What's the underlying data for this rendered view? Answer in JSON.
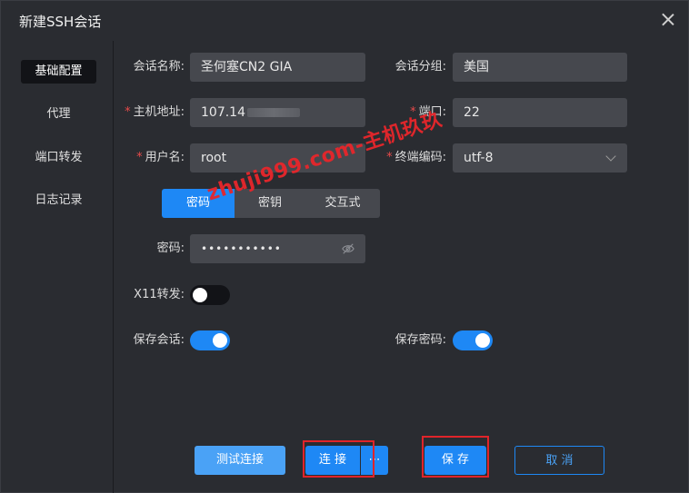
{
  "window": {
    "title": "新建SSH会话"
  },
  "sidebar": {
    "items": [
      {
        "label": "基础配置",
        "active": true
      },
      {
        "label": "代理",
        "active": false
      },
      {
        "label": "端口转发",
        "active": false
      },
      {
        "label": "日志记录",
        "active": false
      }
    ]
  },
  "form": {
    "session_name": {
      "label": "会话名称:",
      "value": "圣何塞CN2 GIA"
    },
    "session_group": {
      "label": "会话分组:",
      "value": "美国"
    },
    "host": {
      "label": "主机地址:",
      "value": "107.14",
      "required": true
    },
    "port": {
      "label": "端口:",
      "value": "22",
      "required": true
    },
    "username": {
      "label": "用户名:",
      "value": "root",
      "required": true
    },
    "encoding": {
      "label": "终端编码:",
      "value": "utf-8",
      "required": true
    },
    "auth_tabs": [
      {
        "label": "密码",
        "active": true
      },
      {
        "label": "密钥",
        "active": false
      },
      {
        "label": "交互式",
        "active": false
      }
    ],
    "password": {
      "label": "密码:",
      "value": "•••••••••••"
    },
    "x11": {
      "label": "X11转发:",
      "on": false
    },
    "save_session": {
      "label": "保存会话:",
      "on": true
    },
    "save_password": {
      "label": "保存密码:",
      "on": true
    }
  },
  "buttons": {
    "test": "测试连接",
    "connect": "连 接",
    "connect_more": "⋯",
    "save": "保 存",
    "cancel": "取 消"
  },
  "watermark": "zhuji999.com-主机玖玖",
  "colors": {
    "accent": "#1e88f5",
    "highlight": "#e0242a",
    "required": "#e84a4a"
  }
}
